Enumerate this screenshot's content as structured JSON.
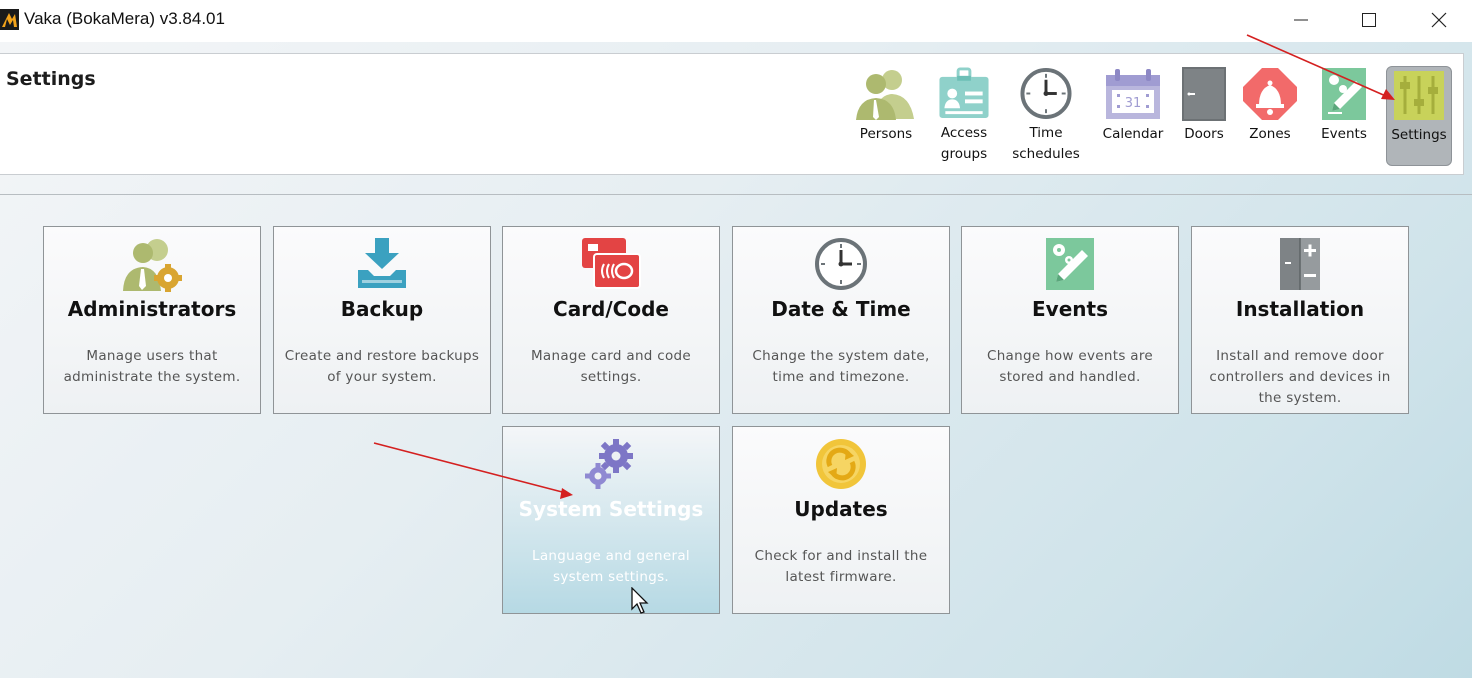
{
  "window": {
    "title": "Vaka (BokaMera) v3.84.01"
  },
  "header": {
    "page_title": "Settings",
    "nav": [
      {
        "id": "persons",
        "label": "Persons",
        "icon": "persons-icon"
      },
      {
        "id": "access-groups",
        "label": "Access\ngroups",
        "icon": "id-card-icon"
      },
      {
        "id": "time-schedules",
        "label": "Time\nschedules",
        "icon": "clock-icon"
      },
      {
        "id": "calendar",
        "label": "Calendar",
        "icon": "calendar-icon"
      },
      {
        "id": "doors",
        "label": "Doors",
        "icon": "door-icon"
      },
      {
        "id": "zones",
        "label": "Zones",
        "icon": "alarm-bell-icon"
      },
      {
        "id": "events",
        "label": "Events",
        "icon": "events-pencil-icon"
      },
      {
        "id": "settings",
        "label": "Settings",
        "icon": "sliders-icon",
        "active": true
      }
    ]
  },
  "tiles": [
    {
      "id": "administrators",
      "title": "Administrators",
      "desc": "Manage users that\nadministrate the system.",
      "icon": "admin-gear-icon"
    },
    {
      "id": "backup",
      "title": "Backup",
      "desc": "Create and restore backups\nof your system.",
      "icon": "download-tray-icon"
    },
    {
      "id": "card-code",
      "title": "Card/Code",
      "desc": "Manage card and code\nsettings.",
      "icon": "rfid-card-icon"
    },
    {
      "id": "date-time",
      "title": "Date & Time",
      "desc": "Change the system date,\ntime and timezone.",
      "icon": "clock-icon"
    },
    {
      "id": "events",
      "title": "Events",
      "desc": "Change how events are\nstored and handled.",
      "icon": "events-gear-pencil-icon"
    },
    {
      "id": "installation",
      "title": "Installation",
      "desc": "Install and remove door\ncontrollers and devices in\nthe system.",
      "icon": "plus-minus-panel-icon"
    },
    {
      "id": "system-settings",
      "title": "System Settings",
      "desc": "Language and general\nsystem settings.",
      "icon": "gears-icon",
      "hover": true
    },
    {
      "id": "updates",
      "title": "Updates",
      "desc": "Check for and install the\nlatest firmware.",
      "icon": "refresh-icon"
    }
  ],
  "colors": {
    "arrow": "#d42020",
    "nav_active_bg": "#b0b5b9",
    "hover_tile_bg": "#b6d9e4"
  }
}
